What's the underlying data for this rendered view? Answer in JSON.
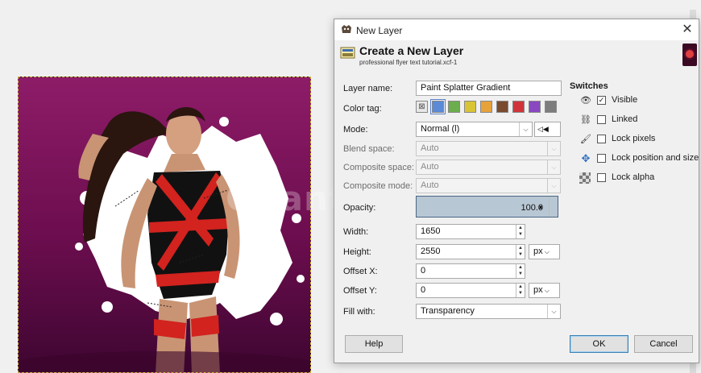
{
  "dialog": {
    "window_title": "New Layer",
    "close_glyph": "✕",
    "heading": "Create a New Layer",
    "subheading": "professional flyer text tutorial.xcf-1"
  },
  "fields": {
    "layer_name_label": "Layer name:",
    "layer_name_value": "Paint Splatter Gradient",
    "color_tag_label": "Color tag:",
    "color_tags": [
      "#7a8fc2",
      "#5b8bd6",
      "#6cae4e",
      "#d8c434",
      "#e7a23a",
      "#7a4b2e",
      "#d0343a",
      "#8a48c0",
      "#7d7d7d"
    ],
    "mode_label": "Mode:",
    "mode_value": "Normal (l)",
    "blend_space_label": "Blend space:",
    "blend_space_value": "Auto",
    "composite_space_label": "Composite space:",
    "composite_space_value": "Auto",
    "composite_mode_label": "Composite mode:",
    "composite_mode_value": "Auto",
    "opacity_label": "Opacity:",
    "opacity_value": "100.0",
    "width_label": "Width:",
    "width_value": "1650",
    "height_label": "Height:",
    "height_value": "2550",
    "size_unit": "px",
    "offset_x_label": "Offset X:",
    "offset_x_value": "0",
    "offset_y_label": "Offset Y:",
    "offset_y_value": "0",
    "offset_unit": "px",
    "fill_label": "Fill with:",
    "fill_value": "Transparency"
  },
  "switches": {
    "title": "Switches",
    "items": [
      {
        "label": "Visible",
        "checked": true,
        "icon": "eye-icon"
      },
      {
        "label": "Linked",
        "checked": false,
        "icon": "chain-icon"
      },
      {
        "label": "Lock pixels",
        "checked": false,
        "icon": "brush-icon"
      },
      {
        "label": "Lock position and size",
        "checked": false,
        "icon": "move-icon"
      },
      {
        "label": "Lock alpha",
        "checked": false,
        "icon": "checker-icon"
      }
    ]
  },
  "buttons": {
    "help": "Help",
    "ok": "OK",
    "cancel": "Cancel"
  },
  "watermark": "Quantrimang",
  "colors": {
    "canvas_gradient_top": "#8e1c68",
    "canvas_gradient_bottom": "#3e0631",
    "opacity_fill": "#b8c7d4"
  }
}
